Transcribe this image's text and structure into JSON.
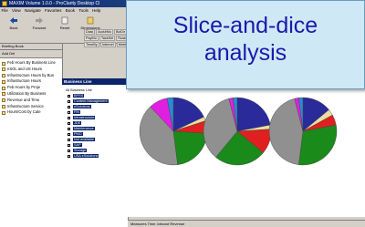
{
  "app": {
    "title": "MAXIM Volume 1.0.0 - ProClarity Desktop Cl",
    "menu": [
      "File",
      "View",
      "Navigate",
      "Favorites",
      "Book",
      "Tools",
      "Help"
    ],
    "toolbar": {
      "back": "Back",
      "forward": "Forward",
      "reset": "Reset",
      "dimensions": "Dimensions"
    },
    "toolbar_tabs": [
      "Data",
      "Acct#Mo",
      "BizDir",
      "Measure",
      "PayMo",
      "TaskSel",
      "RuskCell",
      "Upper",
      "TimeBy",
      "Internet",
      "Metrics",
      "Resourc"
    ],
    "left_panel": {
      "title": "Briefing Book",
      "tools": "Add  Del",
      "items": [
        "Feb Hours By Business Line",
        "eSOL and US Hours",
        "Infrastructure Hours by Bus",
        "Infrastructure Hours",
        "Feb Hours by Proje",
        "Utilization By Business",
        "Revenue and Time",
        "Infrastructure Service",
        "Hours/Cost by Cate"
      ]
    },
    "business_line": {
      "header": "Business Line",
      "root": "All Business Line",
      "items": [
        "BPRS",
        "Content Management",
        "eSolutions",
        "FIN",
        "Infrastructure",
        "JDE",
        "Maintenance",
        "PMO",
        "Not available",
        "SAP",
        "Storage",
        "USA eSolutions"
      ]
    },
    "right_tabs": [
      "Measures",
      "Time",
      "Jobcost",
      "Revenue"
    ],
    "bottom_bar": "Measures  Time  Jobcost  Revenue",
    "pie_colors": [
      "#2a2a9a",
      "#e8e0a0",
      "#e02020",
      "#1a8a1a",
      "#909090",
      "#e020e0",
      "#2a8ad0"
    ],
    "pie_charts": [
      {
        "slices": [
          0.18,
          0.02,
          0.06,
          0.22,
          0.4,
          0.09,
          0.03
        ]
      },
      {
        "slices": [
          0.22,
          0.02,
          0.12,
          0.25,
          0.35,
          0.02,
          0.02
        ]
      },
      {
        "slices": [
          0.14,
          0.03,
          0.05,
          0.3,
          0.44,
          0.02,
          0.02
        ]
      }
    ]
  },
  "callout": {
    "line1": "Slice-and-dice",
    "line2": "analysis"
  }
}
